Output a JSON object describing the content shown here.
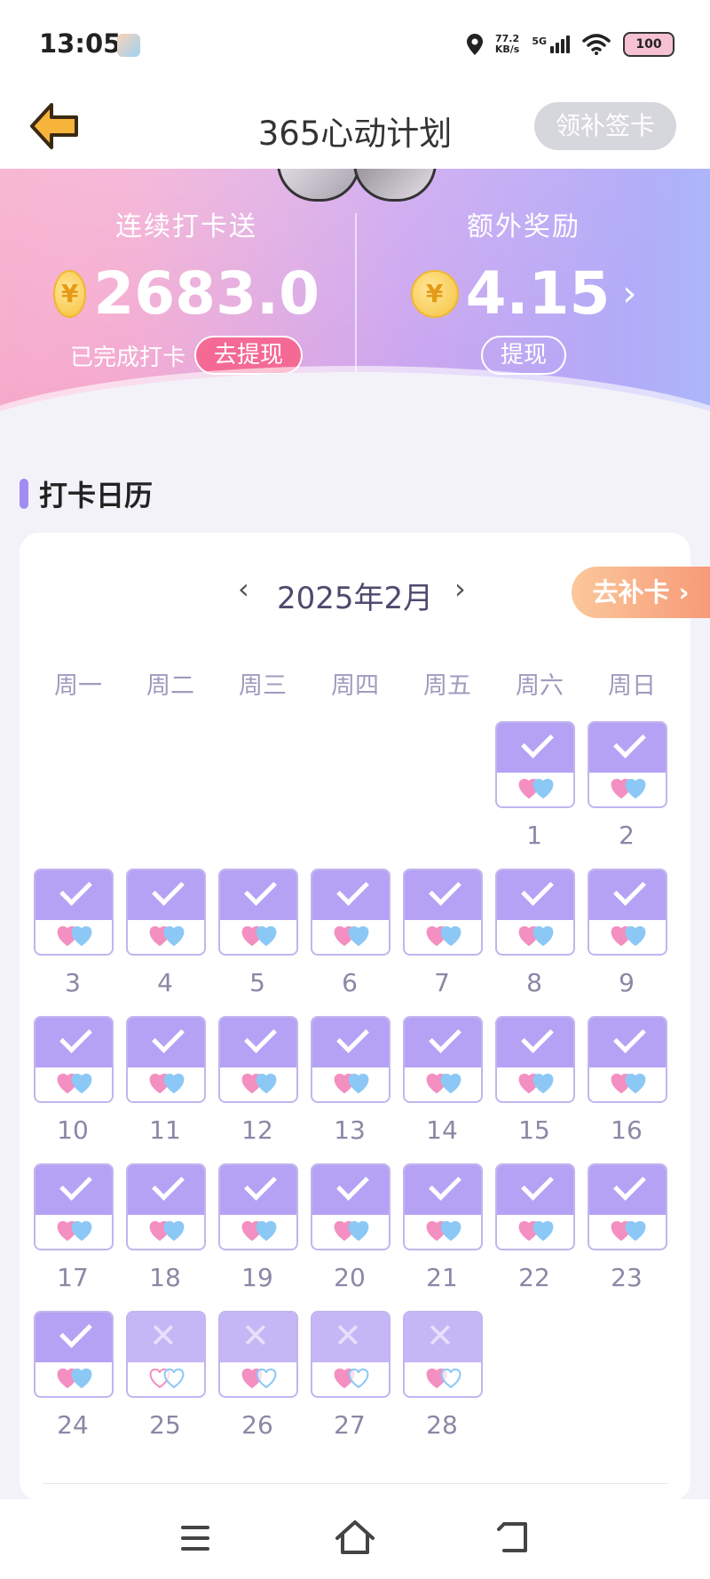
{
  "status_bar": {
    "time": "13:05",
    "net_speed_value": "77.2",
    "net_speed_unit": "KB/s",
    "network": "5G",
    "battery": "100"
  },
  "header": {
    "title": "365心动计划",
    "right_button": "领补签卡"
  },
  "banner": {
    "left_label": "连续打卡送",
    "left_amount": "2683.0",
    "left_status": "已完成打卡",
    "left_button": "去提现",
    "right_label": "额外奖励",
    "right_amount": "4.15",
    "right_button": "提现",
    "coin_symbol": "¥"
  },
  "section": {
    "title": "打卡日历"
  },
  "calendar": {
    "month_label": "2025年2月",
    "prev": "‹",
    "next": "›",
    "bu_button": "去补卡 ›",
    "weekdays": [
      "周一",
      "周二",
      "周三",
      "周四",
      "周五",
      "周六",
      "周日"
    ],
    "days": [
      {
        "d": "1",
        "s": "checked"
      },
      {
        "d": "2",
        "s": "checked"
      },
      {
        "d": "3",
        "s": "checked"
      },
      {
        "d": "4",
        "s": "checked"
      },
      {
        "d": "5",
        "s": "checked"
      },
      {
        "d": "6",
        "s": "checked"
      },
      {
        "d": "7",
        "s": "checked"
      },
      {
        "d": "8",
        "s": "checked"
      },
      {
        "d": "9",
        "s": "checked"
      },
      {
        "d": "10",
        "s": "checked"
      },
      {
        "d": "11",
        "s": "checked"
      },
      {
        "d": "12",
        "s": "checked"
      },
      {
        "d": "13",
        "s": "checked"
      },
      {
        "d": "14",
        "s": "checked"
      },
      {
        "d": "15",
        "s": "checked"
      },
      {
        "d": "16",
        "s": "checked"
      },
      {
        "d": "17",
        "s": "checked"
      },
      {
        "d": "18",
        "s": "checked"
      },
      {
        "d": "19",
        "s": "checked"
      },
      {
        "d": "20",
        "s": "checked"
      },
      {
        "d": "21",
        "s": "checked"
      },
      {
        "d": "22",
        "s": "checked"
      },
      {
        "d": "23",
        "s": "checked"
      },
      {
        "d": "24",
        "s": "checked"
      },
      {
        "d": "25",
        "s": "missed_none"
      },
      {
        "d": "26",
        "s": "missed_pink"
      },
      {
        "d": "27",
        "s": "missed_pink"
      },
      {
        "d": "28",
        "s": "missed_pink"
      }
    ]
  },
  "colors": {
    "accent": "#b5a2f4",
    "heart_pink": "#f38fc1",
    "heart_blue": "#8cc8f5",
    "bu_orange": "#f79a78"
  },
  "nav": {
    "menu_icon": "menu-icon",
    "home_icon": "home-icon",
    "back_icon": "back-icon"
  }
}
